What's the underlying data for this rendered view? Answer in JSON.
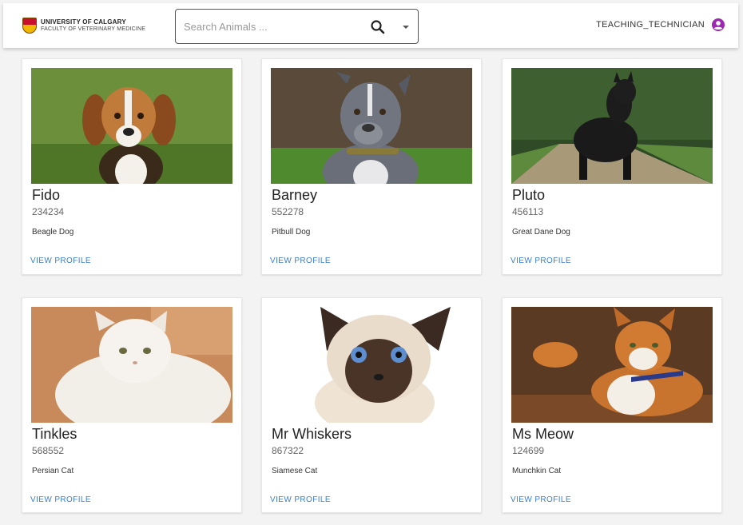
{
  "header": {
    "logo_line1": "UNIVERSITY OF CALGARY",
    "logo_line2": "FACULTY OF VETERINARY MEDICINE",
    "search_placeholder": "Search Animals ...",
    "search_icon": "search-icon",
    "dropdown_icon": "chevron-down-icon",
    "user_name": "TEACHING_TECHNICIAN",
    "user_icon": "account-circle-icon"
  },
  "colors": {
    "accent": "#3a7fd0",
    "user_icon": "#9c27b0"
  },
  "animals": [
    {
      "name": "Fido",
      "id": "234234",
      "breed": "Beagle Dog",
      "link": "VIEW PROFILE"
    },
    {
      "name": "Barney",
      "id": "552278",
      "breed": "Pitbull Dog",
      "link": "VIEW PROFILE"
    },
    {
      "name": "Pluto",
      "id": "456113",
      "breed": "Great Dane Dog",
      "link": "VIEW PROFILE"
    },
    {
      "name": "Tinkles",
      "id": "568552",
      "breed": "Persian Cat",
      "link": "VIEW PROFILE"
    },
    {
      "name": "Mr Whiskers",
      "id": "867322",
      "breed": "Siamese Cat",
      "link": "VIEW PROFILE"
    },
    {
      "name": "Ms Meow",
      "id": "124699",
      "breed": "Munchkin Cat",
      "link": "VIEW PROFILE"
    }
  ]
}
